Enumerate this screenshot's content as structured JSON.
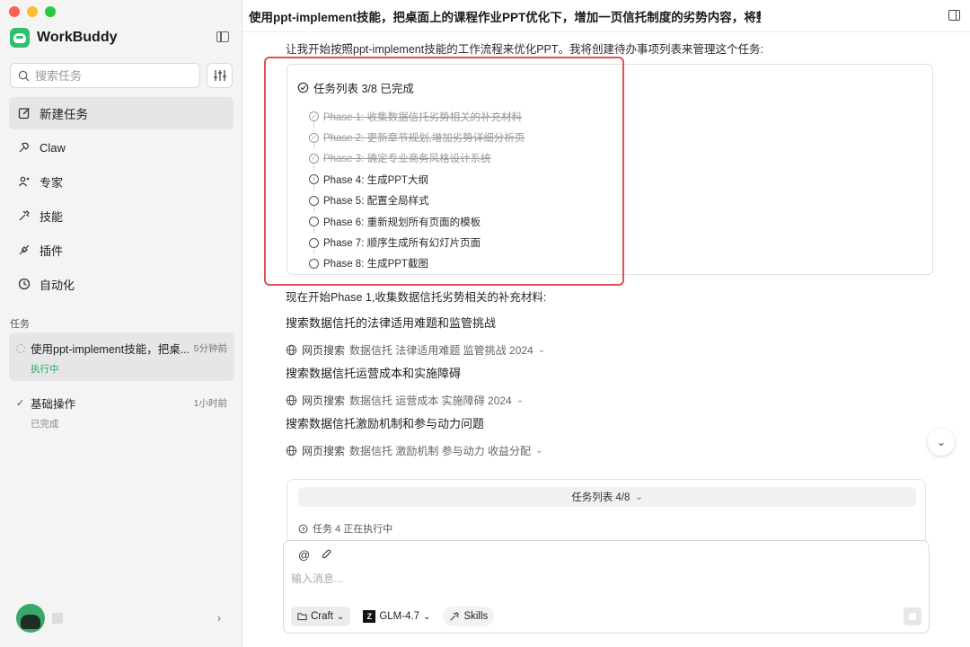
{
  "window": {
    "controls": [
      "#fe5f57",
      "#febc2e",
      "#28c840"
    ]
  },
  "brand": {
    "name": "WorkBuddy",
    "accent": "#2fbf71"
  },
  "search": {
    "placeholder": "搜索任务"
  },
  "nav": {
    "items": [
      {
        "label": "新建任务",
        "icon": "edit-icon"
      },
      {
        "label": "Claw",
        "icon": "claw-icon"
      },
      {
        "label": "专家",
        "icon": "experts-icon"
      },
      {
        "label": "技能",
        "icon": "skills-icon"
      },
      {
        "label": "插件",
        "icon": "plugin-icon"
      },
      {
        "label": "自动化",
        "icon": "clock-icon"
      }
    ]
  },
  "tasks": {
    "section_label": "任务",
    "items": [
      {
        "title": "使用ppt-implement技能，把桌...",
        "time": "5分钟前",
        "status": "执行中"
      },
      {
        "title": "基础操作",
        "time": "1小时前",
        "status": "已完成"
      }
    ]
  },
  "header": {
    "title": "使用ppt-implement技能，把桌面上的课程作业PPT优化下，增加一页信托制度的劣势内容，将整..."
  },
  "conversation": {
    "intro": "让我开始按照ppt-implement技能的工作流程来优化PPT。我将创建待办事项列表来管理这个任务:",
    "todo": {
      "title": "任务列表 3/8 已完成",
      "phases": [
        {
          "text": "Phase 1: 收集数据信托劣势相关的补充材料",
          "state": "done"
        },
        {
          "text": "Phase 2: 更新章节规划,增加劣势详细分析页",
          "state": "done"
        },
        {
          "text": "Phase 3: 确定专业商务风格设计系统",
          "state": "done"
        },
        {
          "text": "Phase 4: 生成PPT大纲",
          "state": "current"
        },
        {
          "text": "Phase 5: 配置全局样式",
          "state": "pending"
        },
        {
          "text": "Phase 6: 重新规划所有页面的模板",
          "state": "pending"
        },
        {
          "text": "Phase 7: 顺序生成所有幻灯片页面",
          "state": "pending"
        },
        {
          "text": "Phase 8: 生成PPT截图",
          "state": "pending"
        }
      ]
    },
    "phase_start": "现在开始Phase 1,收集数据信托劣势相关的补充材料:",
    "searches": [
      {
        "heading": "搜索数据信托的法律适用难题和监管挑战",
        "label": "网页搜索",
        "query": "数据信托 法律适用难题 监管挑战 2024"
      },
      {
        "heading": "搜索数据信托运营成本和实施障碍",
        "label": "网页搜索",
        "query": "数据信托 运营成本 实施障碍 2024"
      },
      {
        "heading": "搜索数据信托激励机制和参与动力问题",
        "label": "网页搜索",
        "query": "数据信托 激励机制 参与动力 收益分配"
      }
    ]
  },
  "progress": {
    "pill": "任务列表 4/8",
    "status": "任务 4 正在执行中"
  },
  "composer": {
    "placeholder": "输入消息...",
    "mode": "Craft",
    "model": "GLM-4.7",
    "model_logo": "Z",
    "skills": "Skills"
  },
  "highlight_color": "#e05252"
}
